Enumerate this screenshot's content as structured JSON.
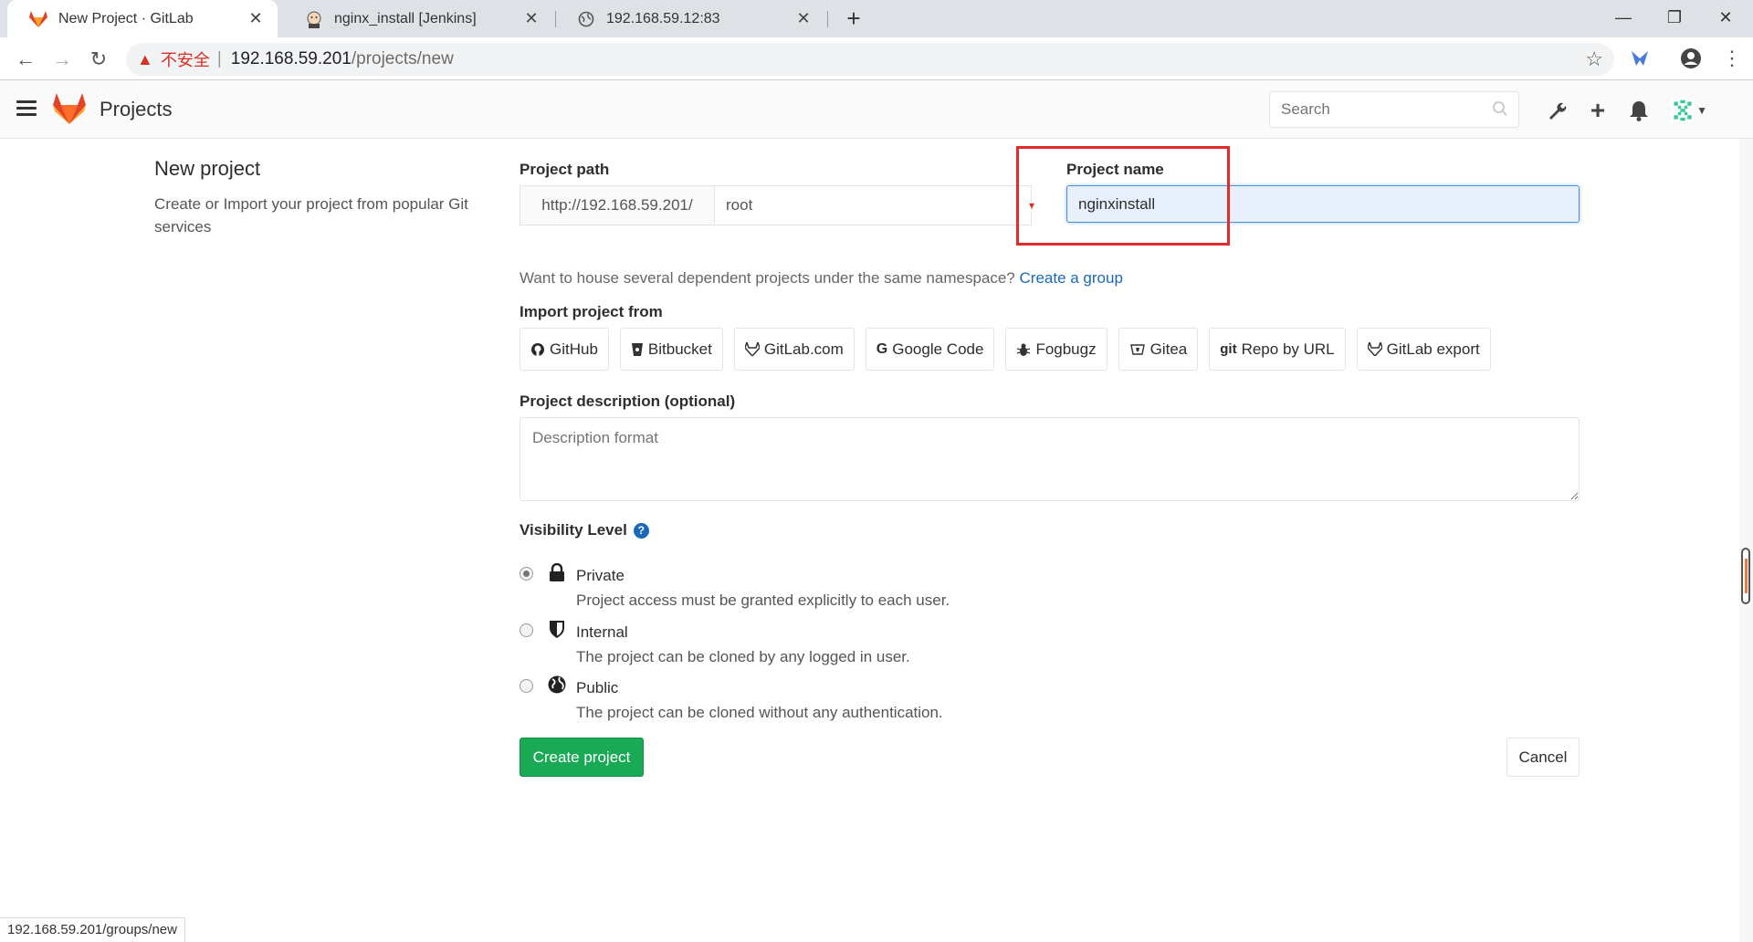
{
  "browser": {
    "tabs": [
      {
        "title": "New Project · GitLab",
        "icon": "gitlab-fox-icon",
        "active": true
      },
      {
        "title": "nginx_install [Jenkins]",
        "icon": "jenkins-icon",
        "active": false
      },
      {
        "title": "192.168.59.12:83",
        "icon": "globe-icon",
        "active": false
      }
    ],
    "address": {
      "insecure_label": "不安全",
      "separator": "|",
      "host": "192.168.59.201",
      "path": "/projects/new"
    }
  },
  "header": {
    "title": "Projects",
    "search_placeholder": "Search"
  },
  "sidebar_info": {
    "title": "New project",
    "description": "Create or Import your project from popular Git services"
  },
  "form": {
    "project_path_label": "Project path",
    "path_prefix": "http://192.168.59.201/",
    "namespace": "root",
    "project_name_label": "Project name",
    "project_name_value": "nginxinstall",
    "namespace_hint": "Want to house several dependent projects under the same namespace?",
    "create_group_link": "Create a group",
    "import_label": "Import project from",
    "import_sources": [
      {
        "label": "GitHub",
        "icon": "github-icon"
      },
      {
        "label": "Bitbucket",
        "icon": "bitbucket-icon"
      },
      {
        "label": "GitLab.com",
        "icon": "gitlab-icon"
      },
      {
        "label": "Google Code",
        "icon": "google-icon"
      },
      {
        "label": "Fogbugz",
        "icon": "bug-icon"
      },
      {
        "label": "Gitea",
        "icon": "gitea-icon"
      },
      {
        "label": "Repo by URL",
        "icon": "git-icon",
        "prefix": "git"
      },
      {
        "label": "GitLab export",
        "icon": "gitlab-icon"
      }
    ],
    "description_label": "Project description (optional)",
    "description_placeholder": "Description format",
    "visibility_label": "Visibility Level",
    "visibility_options": [
      {
        "title": "Private",
        "description": "Project access must be granted explicitly to each user.",
        "icon": "lock-icon",
        "selected": true
      },
      {
        "title": "Internal",
        "description": "The project can be cloned by any logged in user.",
        "icon": "shield-icon",
        "selected": false
      },
      {
        "title": "Public",
        "description": "The project can be cloned without any authentication.",
        "icon": "globe-icon",
        "selected": false
      }
    ],
    "create_button": "Create project",
    "cancel_button": "Cancel"
  },
  "status_bar": {
    "url": "192.168.59.201/groups/new"
  },
  "colors": {
    "create_button": "#1aaa55",
    "link": "#1b69b6",
    "highlight_box": "#e32b2b",
    "insecure": "#d93025"
  }
}
